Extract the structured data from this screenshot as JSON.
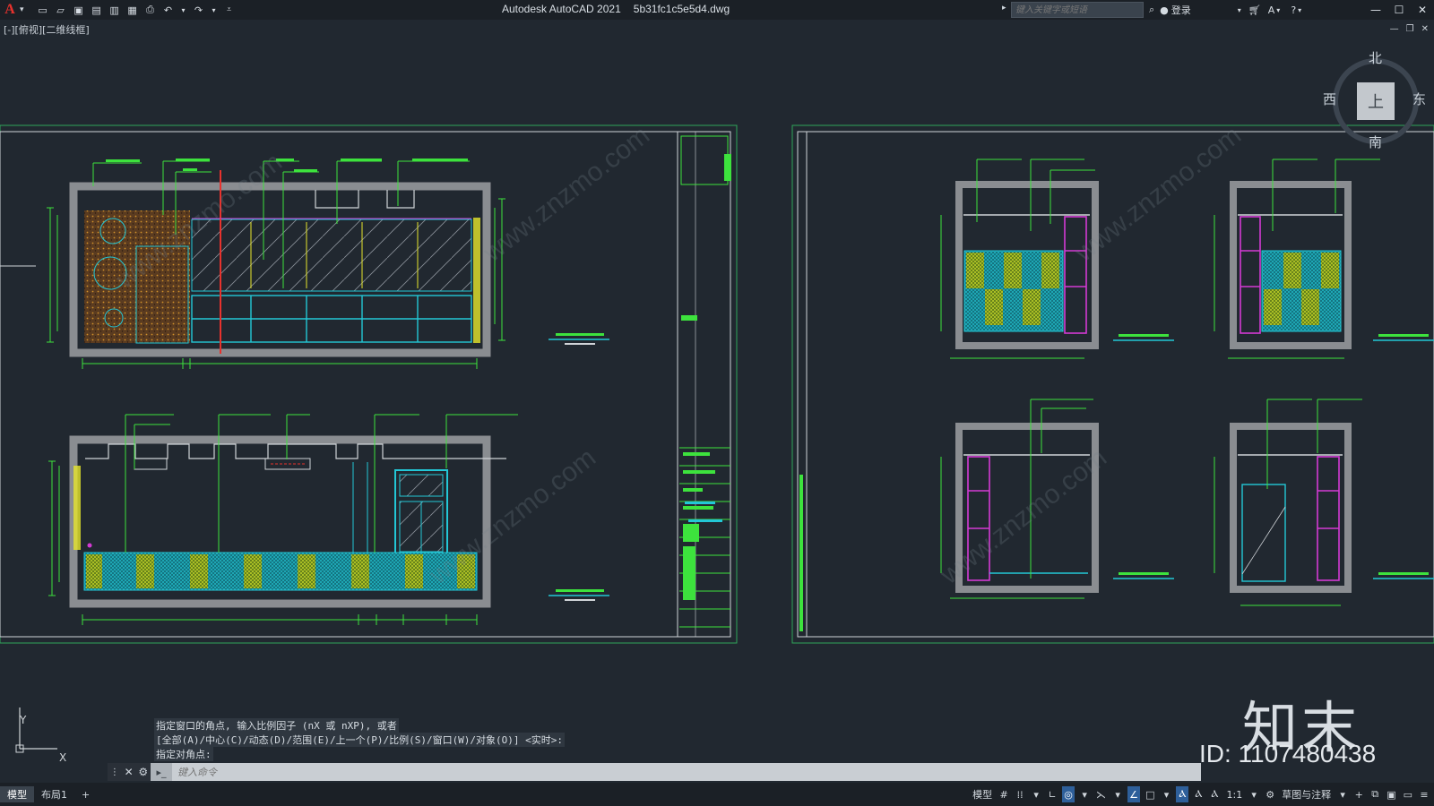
{
  "app": {
    "logo_letter": "A",
    "title": "Autodesk AutoCAD 2021",
    "filename": "5b31fc1c5e5d4.dwg"
  },
  "toolbar": {
    "search_placeholder": "键入关键字或短语",
    "sign_in": "登录"
  },
  "viewport": {
    "label": "[-][俯视][二维线框]"
  },
  "viewcube": {
    "north": "北",
    "south": "南",
    "east": "东",
    "west": "西",
    "face": "上"
  },
  "command": {
    "history": [
      "指定窗口的角点, 输入比例因子 (nX 或 nXP), 或者",
      "[全部(A)/中心(C)/动态(D)/范围(E)/上一个(P)/比例(S)/窗口(W)/对象(O)] <实时>:",
      "指定对角点:"
    ],
    "input_placeholder": "键入命令"
  },
  "layout_tabs": [
    "模型",
    "布局1"
  ],
  "status": {
    "model": "模型",
    "scale": "1:1",
    "workspace": "草图与注释"
  },
  "ucs": {
    "y_label": "Y",
    "x_label": "X"
  },
  "watermark": {
    "brand": "知末",
    "id": "ID: 1107480438"
  },
  "colors": {
    "background": "#212830",
    "sheet_border": "#2fa65a",
    "wall": "#8a8d91",
    "cyan": "#23c7d6",
    "green": "#3de23d",
    "yellow": "#e6e62c",
    "magenta": "#d43ad4",
    "red": "#e8322d"
  }
}
